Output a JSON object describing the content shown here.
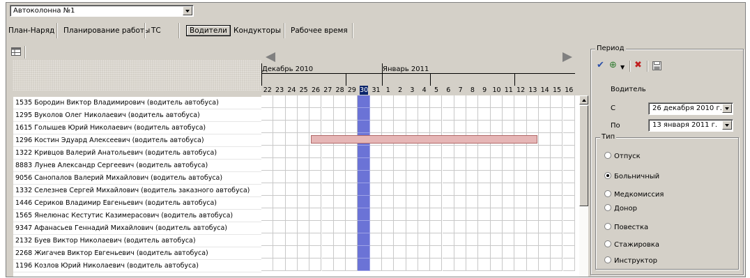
{
  "top": {
    "column_select": "Автоколонна №1"
  },
  "tabs": [
    {
      "label": "План-Наряд",
      "active": false
    },
    {
      "label": "Планирование работы",
      "active": false
    },
    {
      "label": "ТС",
      "active": false
    },
    {
      "label": "Водители",
      "active": true
    },
    {
      "label": "Кондукторы",
      "active": false
    },
    {
      "label": "Рабочее время",
      "active": false
    }
  ],
  "calendar": {
    "months": [
      {
        "label": "Декабрь 2010",
        "start_index": 0
      },
      {
        "label": "Январь 2011",
        "start_index": 10
      }
    ],
    "days": [
      "22",
      "23",
      "24",
      "25",
      "26",
      "27",
      "28",
      "29",
      "30",
      "31",
      "1",
      "2",
      "3",
      "4",
      "5",
      "6",
      "7",
      "8",
      "9",
      "10",
      "11",
      "12",
      "13",
      "14",
      "15",
      "16"
    ],
    "selected_day_index": 8,
    "highlight_color": "#6b73d6",
    "absence": {
      "row_index": 3,
      "from_day": "26",
      "to_day": "13",
      "color": "#e6b6b6"
    }
  },
  "drivers": [
    "1535 Бородин Виктор Владимирович (водитель автобуса)",
    "1295 Вуколов Олег Николаевич (водитель автобуса)",
    "1615 Голышев Юрий Николаевич (водитель автобуса)",
    "1296 Костин Эдуард Алексеевич (водитель автобуса)",
    "1322 Кривцов Валерий Анатольевич (водитель автобуса)",
    "8883 Лунев Александр Сергеевич (водитель автобуса)",
    "9056 Санопалов Валерий Михайлович (водитель автобуса)",
    "1332 Селезнев Сергей Михайлович (водитель заказного автобуса)",
    "1446 Сериков Владимир Евгеньевич (водитель автобуса)",
    "1565 Янелюнас Кестутис Казимерасович (водитель автобуса)",
    "9347 Афанасьев Геннадий Михайлович (водитель автобуса)",
    "2132 Буев Виктор Николаевич (водитель автобуса)",
    "2268 Жигачев Виктор Евгеньевич (водитель автобуса)",
    "1196 Козлов Юрий Николаевич (водитель автобуса)"
  ],
  "period": {
    "legend": "Период",
    "driver_label": "Водитель",
    "from_label": "С",
    "from_value": "26 декабря 2010 г.",
    "to_label": "По",
    "to_value": "13 января 2011 г.",
    "type_legend": "Тип",
    "types": [
      {
        "label": "Отпуск",
        "selected": false
      },
      {
        "label": "Больничный",
        "selected": true
      },
      {
        "label": "Медкомиссия",
        "selected": false
      },
      {
        "label": "Донор",
        "selected": false
      },
      {
        "label": "Повестка",
        "selected": false
      },
      {
        "label": "Стажировка",
        "selected": false
      },
      {
        "label": "Инструктор",
        "selected": false
      }
    ]
  },
  "icons": [
    "table-icon",
    "checkmark-icon",
    "add-icon",
    "dropdown-arrow-icon",
    "delete-icon",
    "save-icon",
    "scroll-left-icon",
    "scroll-right-icon"
  ]
}
